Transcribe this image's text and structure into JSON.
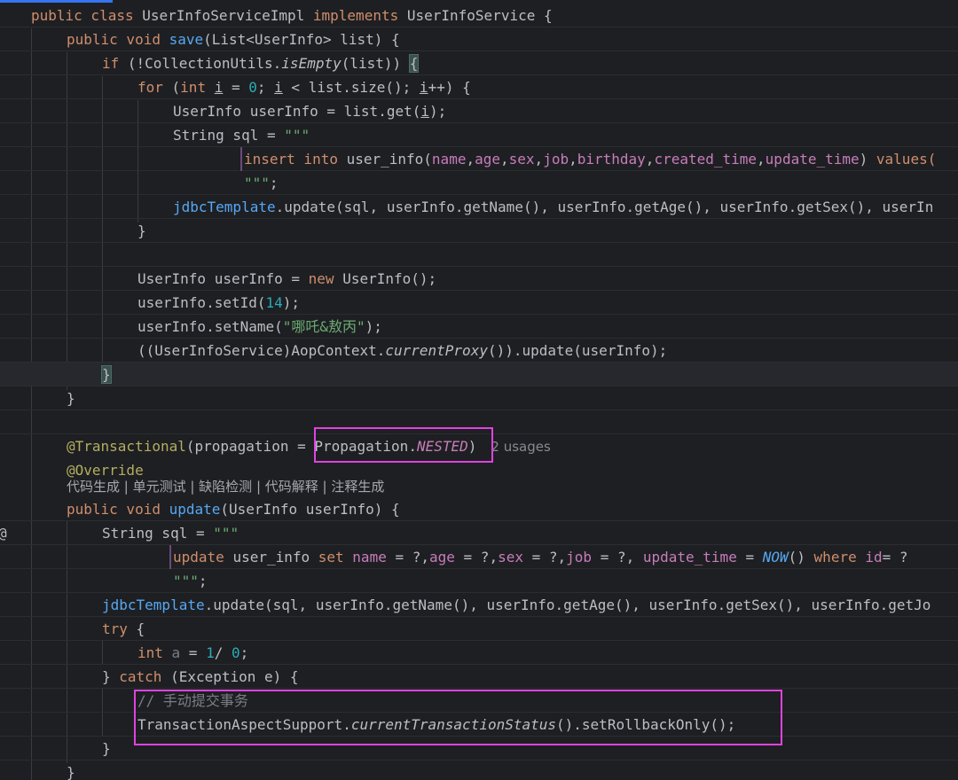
{
  "editor": {
    "lines": [
      "public class UserInfoServiceImpl implements UserInfoService {",
      "public void save(List<UserInfo> list) {",
      "if (!CollectionUtils.isEmpty(list)) {",
      "for (int i = 0; i < list.size(); i++) {",
      "UserInfo userInfo = list.get(i);",
      "String sql = \"\"\"",
      "insert into user_info(name,age,sex,job,birthday,created_time,update_time) values(",
      "\"\"\";",
      "jdbcTemplate.update(sql, userInfo.getName(), userInfo.getAge(), userInfo.getSex(), userIn",
      "}",
      "",
      "UserInfo userInfo = new UserInfo();",
      "userInfo.setId(14);",
      "userInfo.setName(\"哪吒&敖丙\");",
      "((UserInfoService)AopContext.currentProxy()).update(userInfo);",
      "}",
      "}",
      "",
      "@Transactional(propagation = Propagation.NESTED)",
      "@Override",
      "public void update(UserInfo userInfo) {",
      "String sql = \"\"\"",
      "update user_info set name = ?,age = ?,sex = ?,job = ?, update_time = NOW() where id= ?",
      "\"\"\";",
      "jdbcTemplate.update(sql, userInfo.getName(), userInfo.getAge(), userInfo.getSex(), userInfo.getJo",
      "try {",
      "int a = 1/ 0;",
      "} catch (Exception e) {",
      "// 手动提交事务",
      "TransactionAspectSupport.currentTransactionStatus().setRollbackOnly();",
      "}",
      "}"
    ],
    "usages_hint": "2 usages",
    "code_vision": "代码生成 | 单元测试 | 缺陷检测 | 代码解释 | 注释生成",
    "gutter_marker": "@"
  }
}
